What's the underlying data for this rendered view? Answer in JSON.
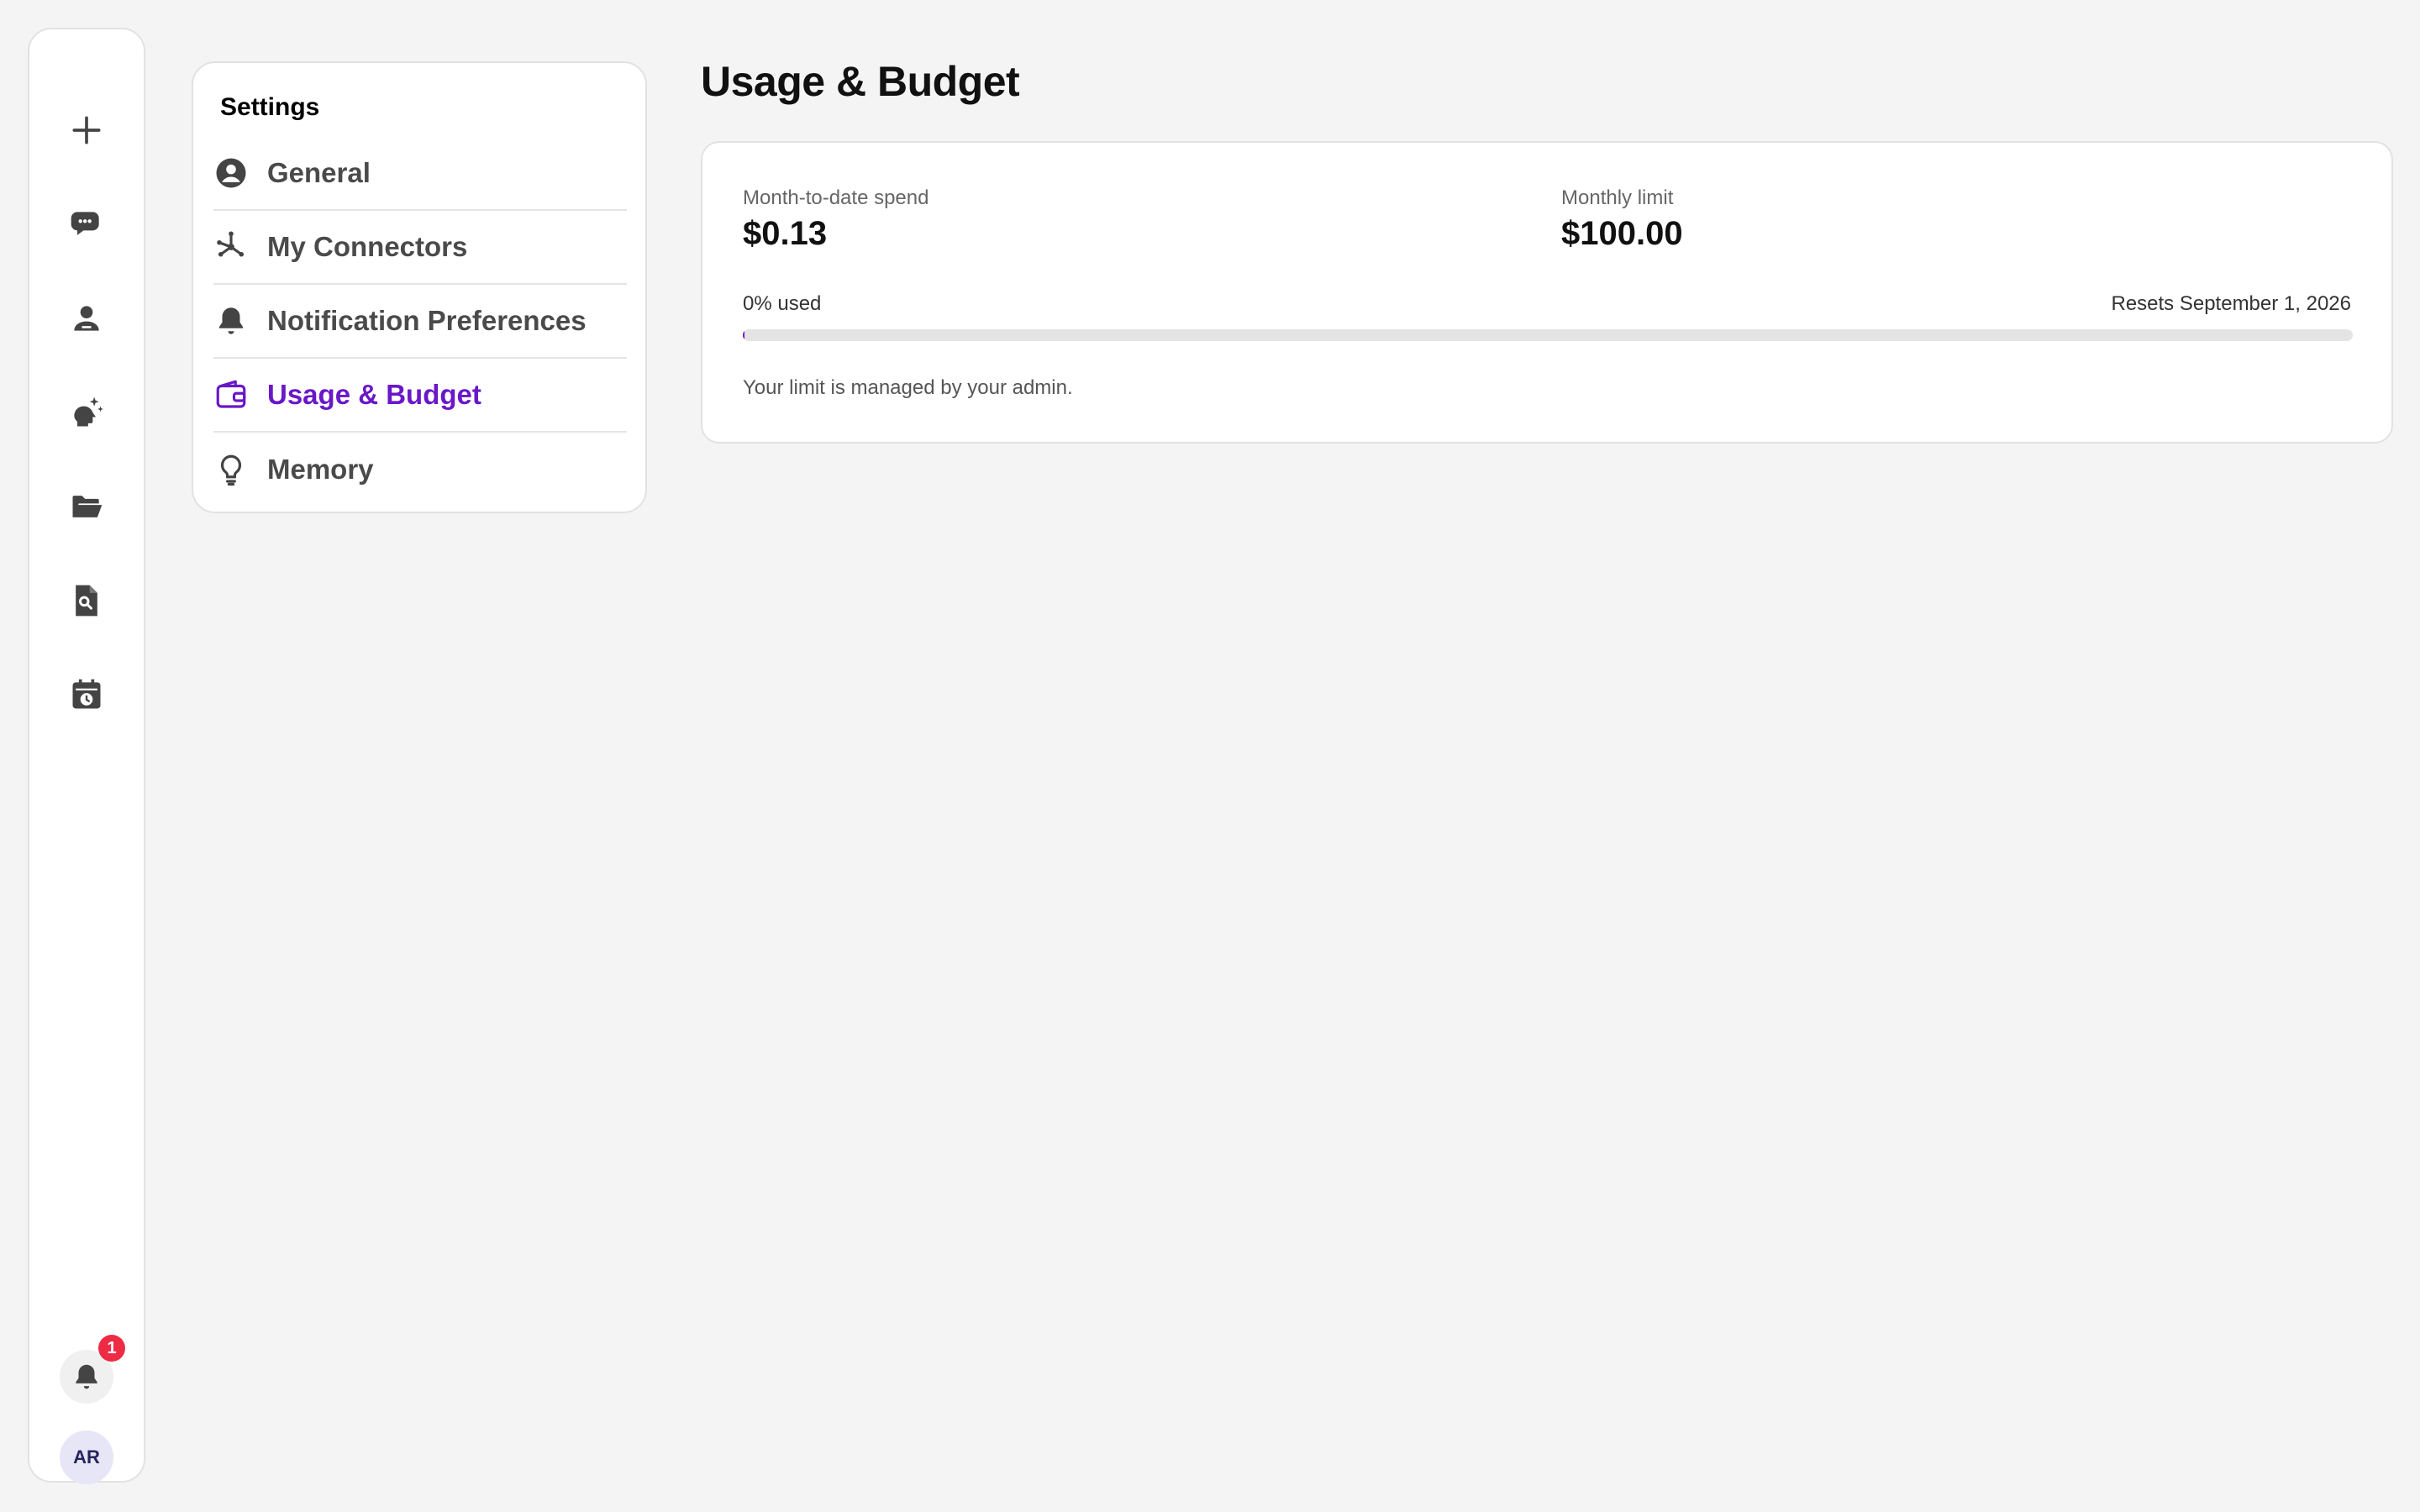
{
  "rail": {
    "items": [
      {
        "icon": "plus-icon",
        "name": "new-chat-button"
      },
      {
        "icon": "chat-bubbles-icon",
        "name": "chats-button"
      },
      {
        "icon": "person-icon",
        "name": "agents-button"
      },
      {
        "icon": "sparkle-head-icon",
        "name": "skills-button"
      },
      {
        "icon": "folder-open-icon",
        "name": "projects-button"
      },
      {
        "icon": "file-search-icon",
        "name": "documents-button"
      },
      {
        "icon": "calendar-clock-icon",
        "name": "schedule-button"
      }
    ],
    "notifications": {
      "icon": "bell-icon",
      "count": "1"
    },
    "avatar": {
      "initials": "AR"
    }
  },
  "settings": {
    "title": "Settings",
    "items": [
      {
        "label": "General",
        "icon": "user-circle-icon",
        "active": false
      },
      {
        "label": "My Connectors",
        "icon": "connectors-icon",
        "active": false
      },
      {
        "label": "Notification Preferences",
        "icon": "bell-icon",
        "active": false
      },
      {
        "label": "Usage & Budget",
        "icon": "wallet-icon",
        "active": true
      },
      {
        "label": "Memory",
        "icon": "lightbulb-icon",
        "active": false
      }
    ]
  },
  "main": {
    "title": "Usage & Budget",
    "spend_label": "Month-to-date spend",
    "spend_value": "$0.13",
    "limit_label": "Monthly limit",
    "limit_value": "$100.00",
    "used_label": "0% used",
    "used_fraction": 0.0013,
    "resets_label": "Resets September 1, 2026",
    "managed_note": "Your limit is managed by your admin."
  },
  "colors": {
    "accent": "#6a17c8",
    "badge": "#ee2b45",
    "background": "#f4f4f4"
  }
}
